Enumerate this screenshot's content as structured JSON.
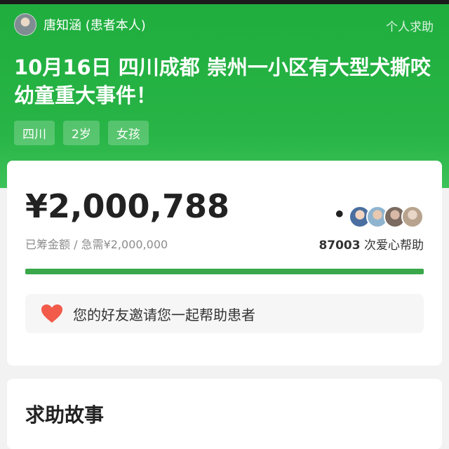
{
  "header": {
    "user_name": "唐知涵 (患者本人)",
    "help_link": "个人求助",
    "title": "10月16日 四川成都 崇州一小区有大型犬撕咬幼童重大事件！",
    "tags": [
      "四川",
      "2岁",
      "女孩"
    ],
    "bg_color": "#28b446"
  },
  "stats": {
    "amount": "¥2,000,788",
    "raised_label": "已筹金额 / 急需¥2,000,000",
    "supporter_count": "87003",
    "supporter_suffix": " 次爱心帮助",
    "progress_fraction": 1.0,
    "progress_color": "#3aa84a",
    "donor_icons": [
      "panda-avatar",
      "person-avatar",
      "person-avatar",
      "person-avatar",
      "person-avatar"
    ]
  },
  "invite": {
    "text": "您的好友邀请您一起帮助患者",
    "icon": "heart-icon",
    "icon_color": "#f25a4a"
  },
  "story": {
    "title": "求助故事"
  }
}
